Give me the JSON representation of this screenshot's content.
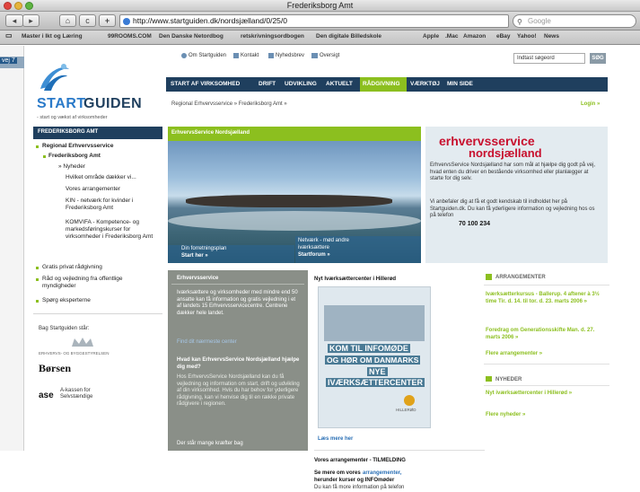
{
  "window": {
    "title": "Frederiksborg Amt"
  },
  "toolbar": {
    "back": "◂",
    "forward": "▸",
    "home": "⌂",
    "reload": "c",
    "add": "+",
    "url": "http://www.startguiden.dk/nordsjælland/0/25/0",
    "search_placeholder": "Google"
  },
  "bookmarks": [
    "Master i Ikt og Læring",
    "99ROOMS.COM",
    "Den Danske Netordbog",
    "retskrivningsordbogen",
    "Den digitale Billedskole",
    "Apple",
    ".Mac",
    "Amazon",
    "eBay",
    "Yahoo!",
    "News"
  ],
  "left_clip": {
    "text": "vej 7"
  },
  "top_utility": {
    "om": "Om Startguiden",
    "kontakt": "Kontakt",
    "nyhedsbrev": "Nyhedsbrev",
    "oversigt": "Oversigt"
  },
  "site_search": {
    "placeholder": "Indtast søgeord",
    "button": "SØG"
  },
  "logo": {
    "start": "START",
    "guiden": "GUIDEN",
    "tagline": "- start og vækst af virksomheder"
  },
  "main_nav": [
    "START AF VIRKSOMHED",
    "DRIFT",
    "UDVIKLING",
    "AKTUELT",
    "RÅDGIVNING",
    "VÆRKTØJ",
    "MIN SIDE"
  ],
  "breadcrumb": "Regional Erhvervsservice  »  Frederiksborg Amt  »",
  "login": "Login  »",
  "sidebar": {
    "header": "FREDERIKSBORG AMT",
    "items": [
      "Regional Erhvervsservice",
      "Frederiksborg Amt",
      "» Nyheder",
      "Hvilket område dækker vi...",
      "Vores arrangementer",
      "KIN - netværk for kvinder i Frederiksborg Amt",
      "KOMVIFA - Kompetence- og markedsføringskurser for virksomheder i Frederiksborg Amt",
      "Gratis privat rådgivning",
      "Råd og vejledning fra offentlige myndigheder",
      "Spørg eksperterne"
    ],
    "supporters_title": "Bag Startguiden står:",
    "supporter1": "ERHVERVS- OG BYGGESTYRELSEN",
    "supporter2": "Børsen",
    "supporter3a": "A-kassen for",
    "supporter3b": "Selvstændige",
    "supporter3_logo": "ase"
  },
  "hero": {
    "title": "ErhvervsService Nordsjælland",
    "left_caption1": "Din forretningsplan",
    "left_caption2": "Start her  »",
    "right_caption1": "Netværk - mød andre",
    "right_caption2": "iværksættere",
    "right_caption3": "Startforum  »"
  },
  "service_box": {
    "logo1": "erhvervsservice",
    "logo2": "nordsjælland",
    "p1": "ErhvervsService Nordsjælland har som mål at hjælpe dig godt på vej, hvad enten du driver en bestående virksomhed eller planlægger at starte for dig selv.",
    "p2": "Vi anbefaler dig at få et godt kendskab til indholdet her på Startguiden.dk. Du kan få yderligere information og vejledning hos os på telefon",
    "phone": "70 100 234"
  },
  "grey_col": {
    "title": "Erhvervsservice",
    "p1": "Iværksættere og virksomheder med mindre end 50 ansatte kan få information og gratis vejledning i et af landets 15 Erhvervsservicecentre. Centrene dækker hele landet.",
    "link": "Find dit nærmeste center",
    "h2": "Hvad kan ErhvervsService Nordsjælland hjælpe dig med?",
    "p2": "Hos ErhvervsService Nordsjælland kan du få vejledning og information om start, drift og udvikling af din virksomhed. Hvis du har behov for yderligere rådgivning, kan vi henvise dig til en række private rådgivere i regionen.",
    "p3": "Der står mange kræfter bag"
  },
  "mid_col": {
    "title": "Nyt Iværksættercenter i Hillerød",
    "poster1": "KOM TIL INFOMØDE",
    "poster2": "OG HØR OM DANMARKS",
    "poster3": "NYE",
    "poster4": "IVÆRKSÆTTERCENTER",
    "poster_town": "HILLERØD",
    "more_link": "Læs mere her",
    "title2": "Vores arrangementer - TILMELDING",
    "p_a": "Se mere om vores",
    "p_link": "arrangementer,",
    "p_b": "herunder kurser og INFOmøder",
    "p_c": "Du kan få more information på telefon"
  },
  "right_col": {
    "arr_header": "ARRANGEMENTER",
    "ev1": "Iværksætterkursus - Ballerup. 4 aftener à 3½ time Tir. d. 14. til tor. d. 23. marts 2006  »",
    "ev2": "Foredrag om Generationsskifte Man. d. 27. marts 2006  »",
    "ev_more": "Flere arrangementer  »",
    "news_header": "NYHEDER",
    "news1": "Nyt iværksættercenter i Hillerød  »",
    "news_more": "Flere nyheder  »"
  },
  "colors": {
    "navy": "#1f3f5e",
    "green": "#8cbf1f",
    "accent_blue": "#2a6fb5",
    "service_red": "#c8102e"
  }
}
